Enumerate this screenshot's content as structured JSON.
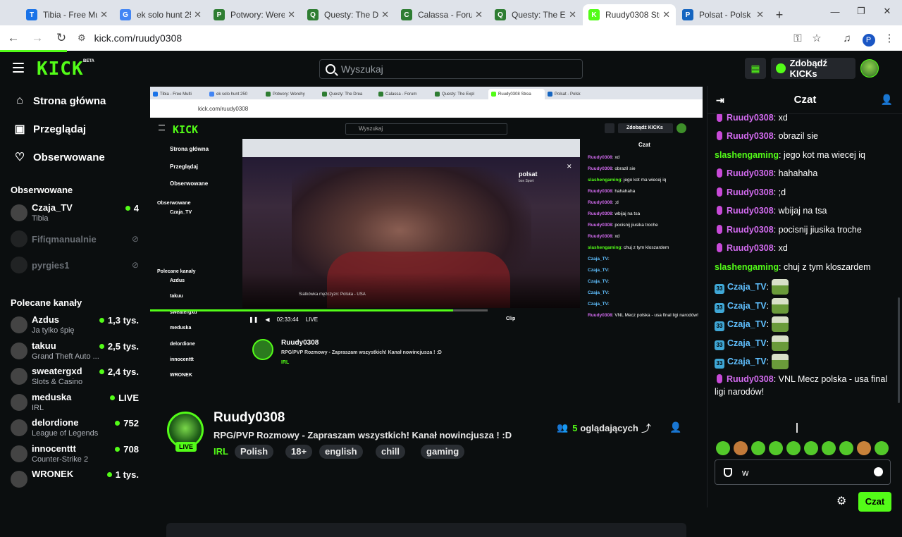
{
  "browser": {
    "tabs": [
      {
        "label": "Tibia - Free Multi",
        "color": "#1a73e8",
        "glyph": "T"
      },
      {
        "label": "ek solo hunt 250",
        "color": "#4285f4",
        "glyph": "G"
      },
      {
        "label": "Potwory: Werehy",
        "color": "#2e7d32",
        "glyph": "P"
      },
      {
        "label": "Questy: The Drea",
        "color": "#2e7d32",
        "glyph": "Q"
      },
      {
        "label": "Calassa - Forum",
        "color": "#2e7d32",
        "glyph": "C"
      },
      {
        "label": "Questy: The Expl",
        "color": "#2e7d32",
        "glyph": "Q"
      },
      {
        "label": "Ruudy0308 Strea",
        "color": "#53fc18",
        "glyph": "K"
      },
      {
        "label": "Polsat - Polsk",
        "color": "#1565c0",
        "glyph": "P"
      }
    ],
    "active_tab": 6,
    "url": "kick.com/ruudy0308",
    "profile_initial": "P"
  },
  "kick": {
    "logo": "KICK",
    "beta": "BETA",
    "search_placeholder": "Wyszukaj",
    "get_kicks": "Zdobądź KICKs"
  },
  "sidebar": {
    "nav": [
      {
        "label": "Strona główna",
        "icon": "home-icon"
      },
      {
        "label": "Przeglądaj",
        "icon": "browse-icon"
      },
      {
        "label": "Obserwowane",
        "icon": "heart-icon"
      }
    ],
    "followed_heading": "Obserwowane",
    "followed": [
      {
        "name": "Czaja_TV",
        "sub": "Tibia",
        "viewers": "4",
        "live": true
      },
      {
        "name": "Fifiqmanualnie",
        "sub": "",
        "viewers": "",
        "live": false
      },
      {
        "name": "pyrgies1",
        "sub": "",
        "viewers": "",
        "live": false
      }
    ],
    "recommended_heading": "Polecane kanały",
    "recommended": [
      {
        "name": "Azdus",
        "sub": "Ja tylko śpię",
        "viewers": "1,3 tys."
      },
      {
        "name": "takuu",
        "sub": "Grand Theft Auto ...",
        "viewers": "2,5 tys."
      },
      {
        "name": "sweatergxd",
        "sub": "Slots & Casino",
        "viewers": "2,4 tys."
      },
      {
        "name": "meduska",
        "sub": "IRL",
        "viewers": "LIVE"
      },
      {
        "name": "delordione",
        "sub": "League of Legends",
        "viewers": "752"
      },
      {
        "name": "innocenttt",
        "sub": "Counter-Strike 2",
        "viewers": "708"
      },
      {
        "name": "WRONEK",
        "sub": "",
        "viewers": "1 tys."
      }
    ]
  },
  "stream": {
    "channel": "Ruudy0308",
    "title": "RPG/PVP Rozmowy - Zapraszam wszystkich! Kanał nowincjusza ! :D",
    "category": "IRL",
    "tags": [
      "Polish",
      "18+",
      "english",
      "chill",
      "gaming"
    ],
    "viewers_count": "5",
    "viewers_label": "oglądających",
    "live": "LIVE"
  },
  "inner": {
    "video_title": "Siatkówka mężczyzn: Polska - USA",
    "time": "02:33:44",
    "live": "LIVE",
    "clip": "Clip",
    "chat_title": "Czat",
    "broadcaster": "polsat",
    "broadcaster_sub": "box Sport"
  },
  "chat": {
    "title": "Czat",
    "messages": [
      {
        "user": "Ruudy0308",
        "type": "mod",
        "text": "xd"
      },
      {
        "user": "Ruudy0308",
        "type": "mod",
        "text": "obrazil sie"
      },
      {
        "user": "slashengaming",
        "type": "plain",
        "text": "jego kot ma wiecej iq"
      },
      {
        "user": "Ruudy0308",
        "type": "mod",
        "text": "hahahaha"
      },
      {
        "user": "Ruudy0308",
        "type": "mod",
        "text": ";d"
      },
      {
        "user": "Ruudy0308",
        "type": "mod",
        "text": "wbijaj na tsa"
      },
      {
        "user": "Ruudy0308",
        "type": "mod",
        "text": "pocisnij jiusika troche"
      },
      {
        "user": "Ruudy0308",
        "type": "mod",
        "text": "xd"
      },
      {
        "user": "slashengaming",
        "type": "plain",
        "text": "chuj z tym kloszardem"
      },
      {
        "user": "Czaja_TV",
        "type": "sub",
        "text": ""
      },
      {
        "user": "Czaja_TV",
        "type": "sub",
        "text": ""
      },
      {
        "user": "Czaja_TV",
        "type": "sub",
        "text": ""
      },
      {
        "user": "Czaja_TV",
        "type": "sub",
        "text": ""
      },
      {
        "user": "Czaja_TV",
        "type": "sub",
        "text": ""
      },
      {
        "user": "Ruudy0308",
        "type": "mod",
        "text": "VNL Mecz polska - usa final ligi narodów!"
      }
    ],
    "sub_badge": "33",
    "input_value": "w",
    "send": "Czat"
  },
  "colors": {
    "accent": "#53fc18",
    "mod": "#d36bf0",
    "sub_name": "#60c0ff",
    "background": "#0b0e0f"
  }
}
